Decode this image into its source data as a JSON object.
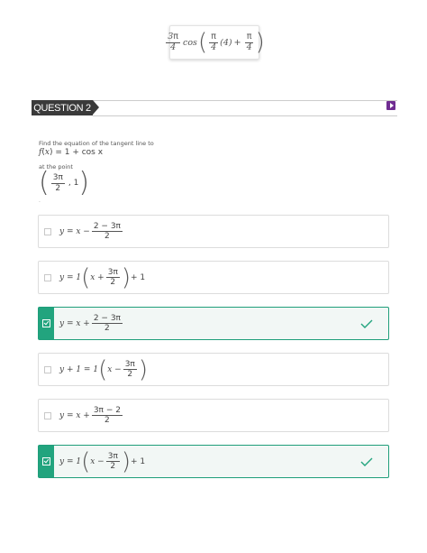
{
  "top_expression": {
    "three": "3",
    "pi": "π",
    "four": "4",
    "cos": "cos",
    "inner": "(4)",
    "plus": "+"
  },
  "question": {
    "label": "QUESTION 2"
  },
  "prompt": "Find the equation of the tangent line to",
  "function": {
    "lhs": "f",
    "arg": "x",
    "rhs": "= 1 + cos x"
  },
  "at_point_label": "at the point",
  "point": {
    "num": "3π",
    "den": "2",
    "y": ", 1"
  },
  "dot": ".",
  "options": [
    {
      "lead": "y = x −",
      "num": "2 − 3π",
      "den": "2",
      "correct": false
    },
    {
      "lead": "y = 1",
      "inner": "x +",
      "num": "3π",
      "den": "2",
      "tail": "+ 1",
      "correct": false
    },
    {
      "lead": "y = x +",
      "num": "2 − 3π",
      "den": "2",
      "correct": true
    },
    {
      "lead": "y + 1 = 1",
      "inner": "x −",
      "num": "3π",
      "den": "2",
      "tail": "",
      "correct": false
    },
    {
      "lead": "y = x +",
      "num": "3π − 2",
      "den": "2",
      "correct": false
    },
    {
      "lead": "y = 1",
      "inner": "x −",
      "num": "3π",
      "den": "2",
      "tail": "+ 1",
      "correct": true
    }
  ],
  "colors": {
    "correct_accent": "#22a47e",
    "correct_border": "#1f9e7a",
    "play_button": "#6f2c91",
    "question_tab": "#3a3a3a"
  },
  "icons": {
    "play": "play-icon",
    "check": "check-icon",
    "checkbox": "checkbox-icon"
  }
}
